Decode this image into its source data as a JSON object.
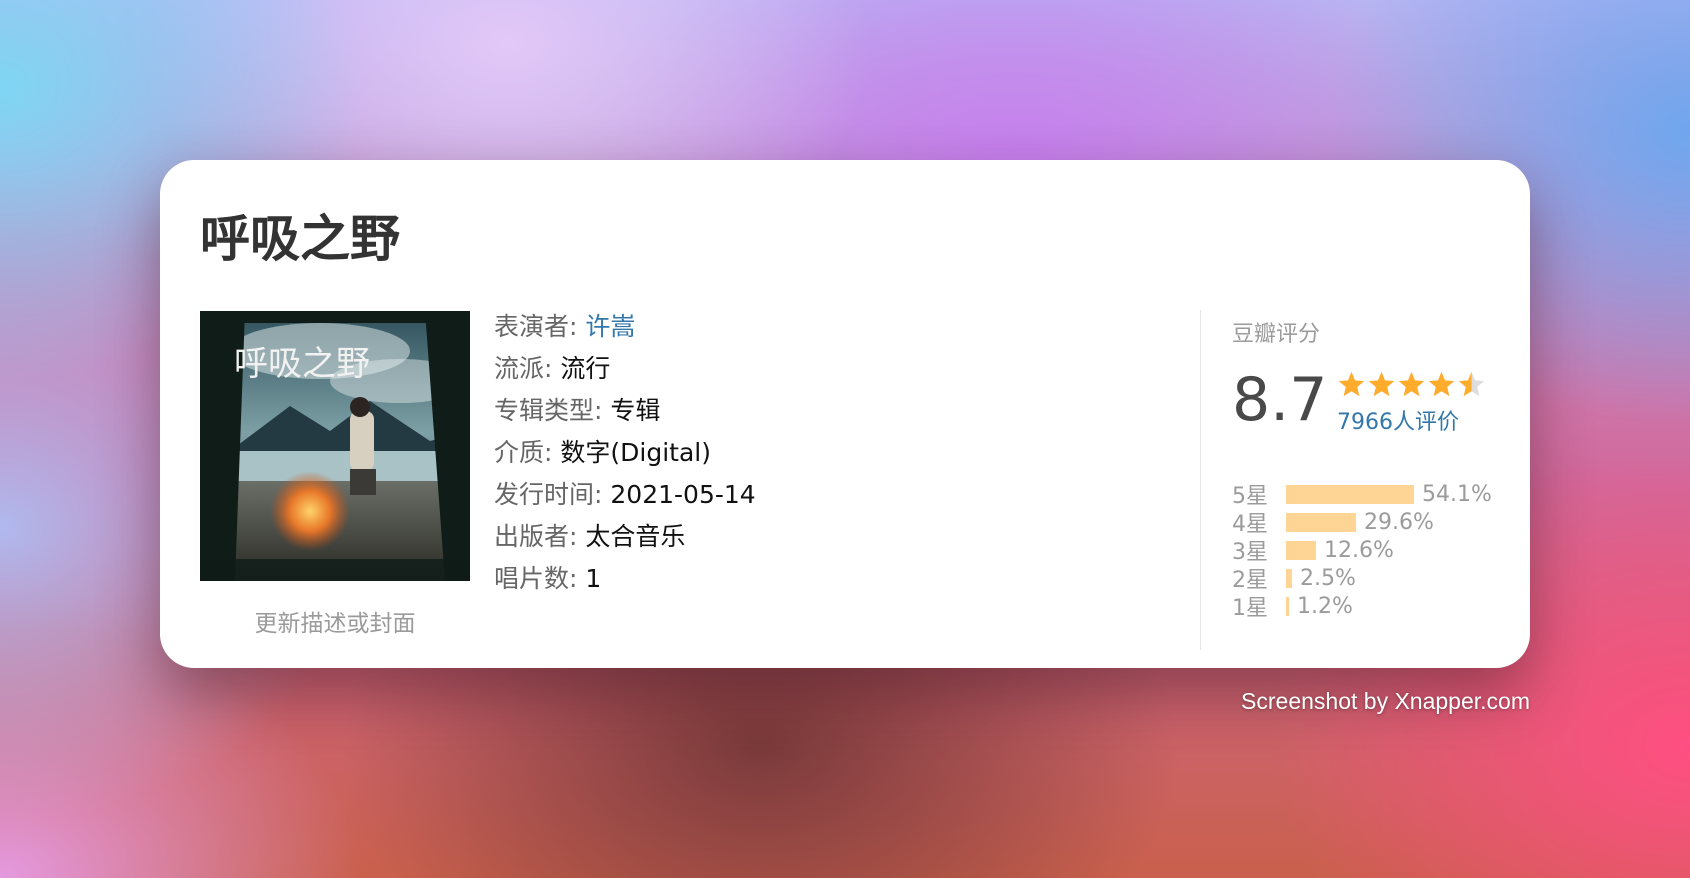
{
  "album": {
    "title": "呼吸之野",
    "cover_text": "呼吸之野",
    "update_link": "更新描述或封面"
  },
  "info": [
    {
      "label": "表演者:",
      "value": "许嵩",
      "link": true
    },
    {
      "label": "流派:",
      "value": "流行",
      "link": false
    },
    {
      "label": "专辑类型:",
      "value": "专辑",
      "link": false
    },
    {
      "label": "介质:",
      "value": "数字(Digital)",
      "link": false
    },
    {
      "label": "发行时间:",
      "value": "2021-05-14",
      "link": false
    },
    {
      "label": "出版者:",
      "value": "太合音乐",
      "link": false
    },
    {
      "label": "唱片数:",
      "value": "1",
      "link": false
    }
  ],
  "rating": {
    "title": "豆瓣评分",
    "score": "8.7",
    "stars_out_of_5": 4.5,
    "votes": "7966人评价",
    "distribution": [
      {
        "label": "5星",
        "percent": "54.1%",
        "value": 54.1
      },
      {
        "label": "4星",
        "percent": "29.6%",
        "value": 29.6
      },
      {
        "label": "3星",
        "percent": "12.6%",
        "value": 12.6
      },
      {
        "label": "2星",
        "percent": "2.5%",
        "value": 2.5
      },
      {
        "label": "1星",
        "percent": "1.2%",
        "value": 1.2
      }
    ]
  },
  "colors": {
    "link": "#3377aa",
    "star": "#ffac2d",
    "bar": "#ffd596"
  },
  "watermark": "Screenshot by Xnapper.com"
}
